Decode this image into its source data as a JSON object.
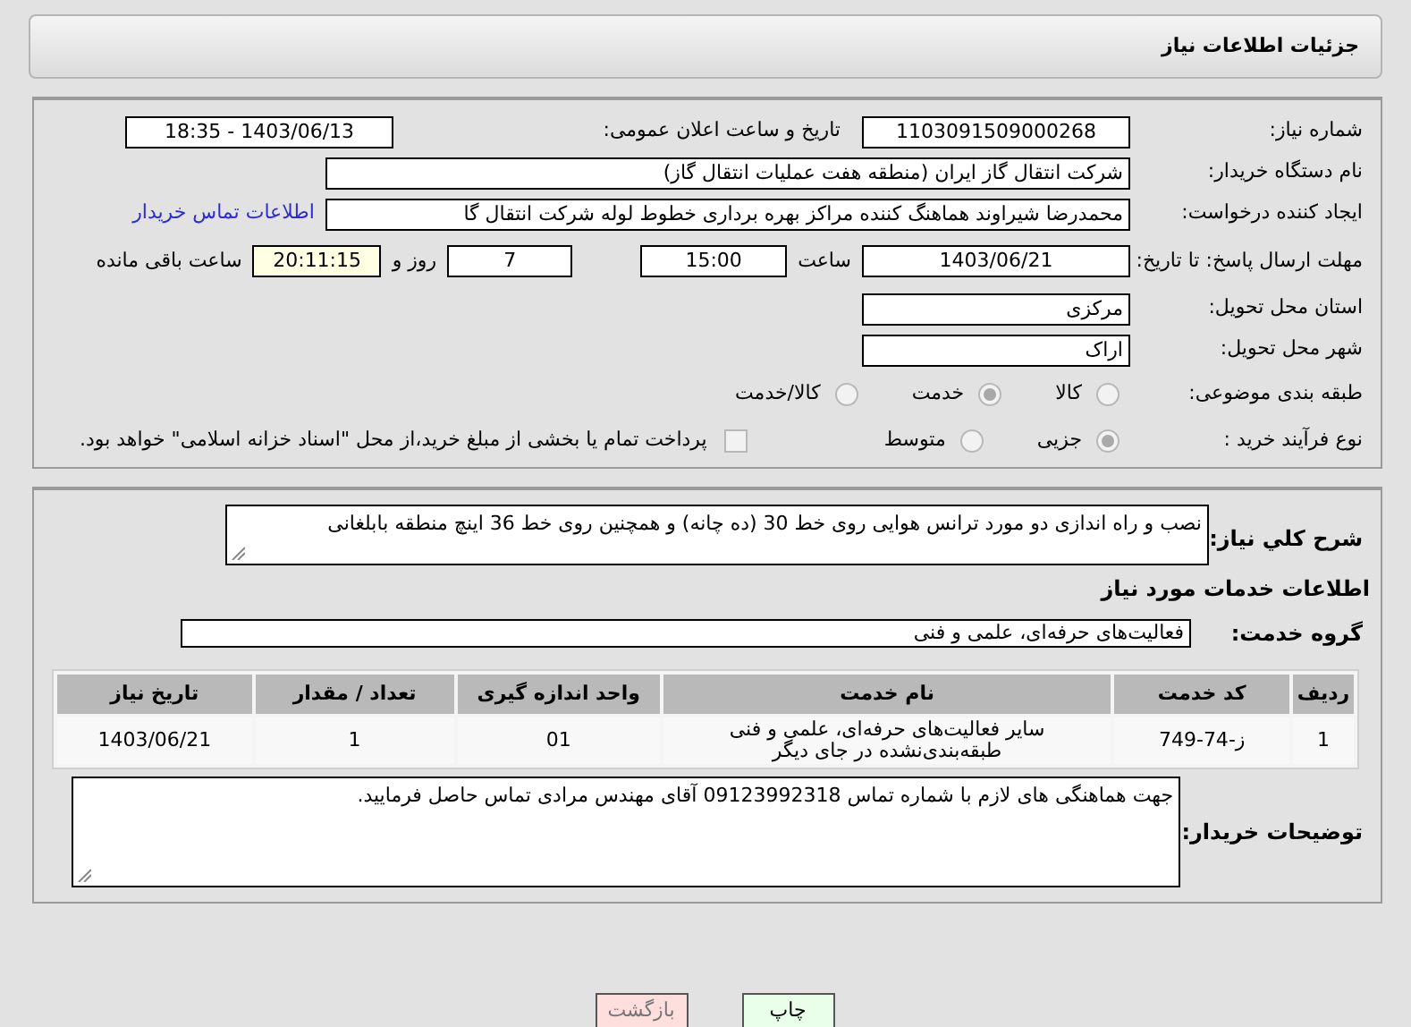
{
  "header": {
    "title": "جزئیات اطلاعات نیاز"
  },
  "need_number": {
    "label": "شماره نیاز:",
    "value": "1103091509000268"
  },
  "announce": {
    "label": "تاریخ و ساعت اعلان عمومی:",
    "value": "1403/06/13 - 18:35"
  },
  "buyer_org": {
    "label": "نام دستگاه خریدار:",
    "value": "شرکت انتقال گاز ایران (منطقه هفت عملیات انتقال گاز)"
  },
  "requester": {
    "label": "ایجاد کننده درخواست:",
    "value": "محمدرضا شیراوند هماهنگ کننده مراکز بهره برداری خطوط لوله  شرکت انتقال گا",
    "link": "اطلاعات تماس خریدار"
  },
  "deadline": {
    "label": "مهلت ارسال پاسخ: تا تاریخ:",
    "date": "1403/06/21",
    "time_label": "ساعت",
    "time": "15:00",
    "days": "7",
    "days_label": "روز و",
    "remaining": "20:11:15",
    "remaining_label": "ساعت باقی مانده"
  },
  "province": {
    "label": "استان محل تحویل:",
    "value": "مرکزی"
  },
  "city": {
    "label": "شهر محل تحویل:",
    "value": "اراک"
  },
  "category": {
    "label": "طبقه بندی موضوعی:",
    "options": [
      {
        "label": "کالا",
        "selected": false
      },
      {
        "label": "خدمت",
        "selected": true
      },
      {
        "label": "کالا/خدمت",
        "selected": false
      }
    ]
  },
  "process": {
    "label": "نوع فرآیند خرید :",
    "options": [
      {
        "label": "جزیی",
        "selected": true
      },
      {
        "label": "متوسط",
        "selected": false
      }
    ],
    "payment": {
      "checked": false,
      "label": "پرداخت تمام یا بخشی از مبلغ خرید،از محل \"اسناد خزانه اسلامی\" خواهد بود."
    }
  },
  "description": {
    "label": "شرح کلي نياز:",
    "value": "نصب و راه اندازی دو مورد ترانس هوایی روی خط 30 (ده چانه) و همچنین روی خط 36  اینچ منطقه بابلغانی"
  },
  "services_title": "اطلاعات خدمات مورد نیاز",
  "service_group": {
    "label": "گروه خدمت:",
    "value": "فعالیت‌های حرفه‌ای، علمی و فنی"
  },
  "table": {
    "columns": [
      "ردیف",
      "کد خدمت",
      "نام خدمت",
      "واحد اندازه گیری",
      "تعداد / مقدار",
      "تاریخ نیاز"
    ],
    "rows": [
      [
        "1",
        "ز-74-749",
        "سایر فعالیت‌های حرفه‌ای، علمی و فنی طبقه‌بندی‌نشده در جای دیگر",
        "01",
        "1",
        "1403/06/21"
      ]
    ]
  },
  "buyer_notes": {
    "label": "توضیحات خریدار:",
    "value": "جهت هماهنگی های لازم با شماره تماس 09123992318 آقای مهندس مرادی تماس حاصل فرمایید."
  },
  "buttons": [
    {
      "label": "چاپ",
      "kind": "print"
    },
    {
      "label": "بازگشت",
      "kind": "back"
    }
  ]
}
